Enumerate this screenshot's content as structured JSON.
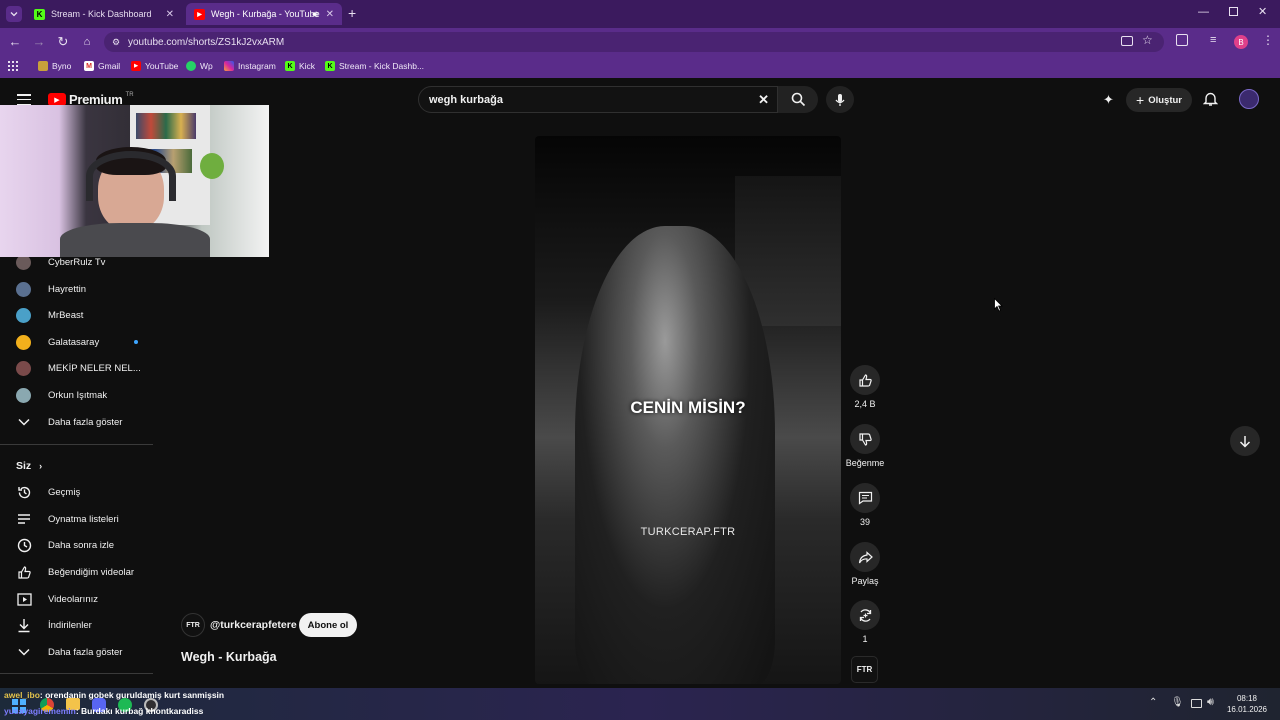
{
  "browser": {
    "tabs": [
      {
        "label": "Stream - Kick Dashboard",
        "active": false
      },
      {
        "label": "Wegh - Kurbağa - YouTube",
        "active": true
      }
    ],
    "url": "youtube.com/shorts/ZS1kJ2vxARM",
    "bookmarks": [
      "Byno",
      "Gmail",
      "YouTube",
      "Wp",
      "Instagram",
      "Kick",
      "Stream - Kick Dashb..."
    ],
    "profile_initial": "B"
  },
  "youtube": {
    "logo": "Premium",
    "region": "TR",
    "search_value": "wegh kurbağa",
    "create_label": "Oluştur",
    "sidebar": {
      "subscriptions": [
        {
          "name": "CyberRulz Tv"
        },
        {
          "name": "Hayrettin"
        },
        {
          "name": "MrBeast"
        },
        {
          "name": "Galatasaray"
        },
        {
          "name": "MEKİP NELER NEL..."
        },
        {
          "name": "Orkun Işıtmak"
        }
      ],
      "show_more": "Daha fazla göster",
      "you_header": "Siz",
      "you_items": [
        "Geçmiş",
        "Oynatma listeleri",
        "Daha sonra izle",
        "Beğendiğim videolar",
        "Videolarınız",
        "İndirilenler",
        "Daha fazla göster"
      ]
    },
    "short": {
      "caption": "CENİN MİSİN?",
      "watermark": "TURKCERAP.FTR",
      "channel_badge": "FTR",
      "channel_handle": "@turkcerapfetere",
      "subscribe_label": "Abone ol",
      "title": "Wegh - Kurbağa",
      "likes": "2,4 B",
      "dislike_label": "Beğenme",
      "comments": "39",
      "share_label": "Paylaş",
      "remix_count": "1",
      "sound_badge": "FTR"
    }
  },
  "overlay": {
    "chat": [
      {
        "user": "awel_ibo",
        "message": ": orendanin gobek guruldamiş kurt sanmişsin"
      },
      {
        "user": "yusayagirememin",
        "message": ": Burdakı kurbağ khontkaradiss"
      }
    ]
  },
  "taskbar": {
    "time": "08:18",
    "date": "16.01.2026"
  }
}
